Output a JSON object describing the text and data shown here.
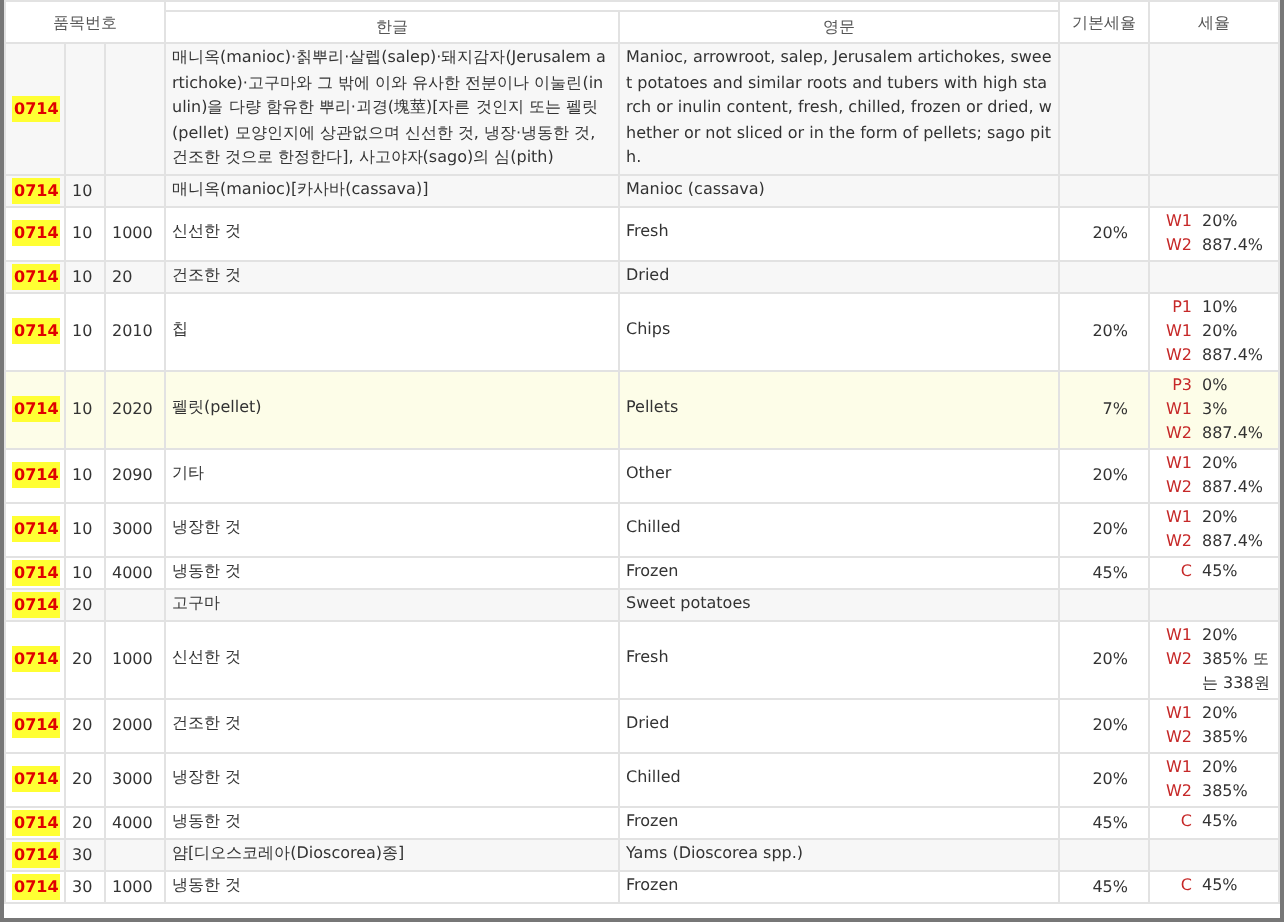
{
  "header": {
    "code": "품목번호",
    "korean": "한글",
    "english": "영문",
    "base_rate": "기본세율",
    "concession_rate": "세율"
  },
  "rows": [
    {
      "kind": "heading",
      "highlighted": false,
      "heading": "0714",
      "sub1": "",
      "sub2": "",
      "korean": "매니옥(manioc)·칡뿌리·살렙(salep)·돼지감자(Jerusalem artichoke)·고구마와 그 밖에 이와 유사한 전분이나 이눌린(inulin)을 다량 함유한 뿌리·괴경(塊莖)[자른 것인지 또는 펠릿(pellet) 모양인지에 상관없으며 신선한 것, 냉장·냉동한 것, 건조한 것으로 한정한다], 사고야자(sago)의 심(pith)",
      "english": "Manioc, arrowroot, salep, Jerusalem artichokes, sweet potatoes and similar roots and tubers with high starch or inulin content, fresh, chilled, frozen or dried, whether or not sliced or in the form of pellets; sago pith.",
      "base": "",
      "rates": []
    },
    {
      "kind": "heading",
      "highlighted": false,
      "heading": "0714",
      "sub1": "10",
      "sub2": "",
      "korean": "매니옥(manioc)[카사바(cassava)]",
      "english": "Manioc (cassava)",
      "base": "",
      "rates": []
    },
    {
      "kind": "item",
      "highlighted": false,
      "heading": "0714",
      "sub1": "10",
      "sub2": "1000",
      "korean": "신선한 것",
      "english": "Fresh",
      "base": "20%",
      "rates": [
        {
          "code": "W1",
          "value": "20%"
        },
        {
          "code": "W2",
          "value": "887.4%"
        }
      ]
    },
    {
      "kind": "heading",
      "highlighted": false,
      "heading": "0714",
      "sub1": "10",
      "sub2": "20",
      "korean": "건조한 것",
      "english": "Dried",
      "base": "",
      "rates": []
    },
    {
      "kind": "item",
      "highlighted": false,
      "heading": "0714",
      "sub1": "10",
      "sub2": "2010",
      "korean": "칩",
      "english": "Chips",
      "base": "20%",
      "rates": [
        {
          "code": "P1",
          "value": "10%"
        },
        {
          "code": "W1",
          "value": "20%"
        },
        {
          "code": "W2",
          "value": "887.4%"
        }
      ]
    },
    {
      "kind": "item",
      "highlighted": true,
      "heading": "0714",
      "sub1": "10",
      "sub2": "2020",
      "korean": "펠릿(pellet)",
      "english": "Pellets",
      "base": "7%",
      "rates": [
        {
          "code": "P3",
          "value": "0%"
        },
        {
          "code": "W1",
          "value": "3%"
        },
        {
          "code": "W2",
          "value": "887.4%"
        }
      ]
    },
    {
      "kind": "item",
      "highlighted": false,
      "heading": "0714",
      "sub1": "10",
      "sub2": "2090",
      "korean": "기타",
      "english": "Other",
      "base": "20%",
      "rates": [
        {
          "code": "W1",
          "value": "20%"
        },
        {
          "code": "W2",
          "value": "887.4%"
        }
      ]
    },
    {
      "kind": "item",
      "highlighted": false,
      "heading": "0714",
      "sub1": "10",
      "sub2": "3000",
      "korean": "냉장한 것",
      "english": "Chilled",
      "base": "20%",
      "rates": [
        {
          "code": "W1",
          "value": "20%"
        },
        {
          "code": "W2",
          "value": "887.4%"
        }
      ]
    },
    {
      "kind": "item",
      "highlighted": false,
      "heading": "0714",
      "sub1": "10",
      "sub2": "4000",
      "korean": "냉동한 것",
      "english": "Frozen",
      "base": "45%",
      "rates": [
        {
          "code": "C",
          "value": "45%"
        }
      ]
    },
    {
      "kind": "heading",
      "highlighted": false,
      "heading": "0714",
      "sub1": "20",
      "sub2": "",
      "korean": "고구마",
      "english": "Sweet potatoes",
      "base": "",
      "rates": []
    },
    {
      "kind": "item",
      "highlighted": false,
      "heading": "0714",
      "sub1": "20",
      "sub2": "1000",
      "korean": "신선한 것",
      "english": "Fresh",
      "base": "20%",
      "rates": [
        {
          "code": "W1",
          "value": "20%"
        },
        {
          "code": "W2",
          "value": "385% 또는 338원"
        }
      ]
    },
    {
      "kind": "item",
      "highlighted": false,
      "heading": "0714",
      "sub1": "20",
      "sub2": "2000",
      "korean": "건조한 것",
      "english": "Dried",
      "base": "20%",
      "rates": [
        {
          "code": "W1",
          "value": "20%"
        },
        {
          "code": "W2",
          "value": "385%"
        }
      ]
    },
    {
      "kind": "item",
      "highlighted": false,
      "heading": "0714",
      "sub1": "20",
      "sub2": "3000",
      "korean": "냉장한 것",
      "english": "Chilled",
      "base": "20%",
      "rates": [
        {
          "code": "W1",
          "value": "20%"
        },
        {
          "code": "W2",
          "value": "385%"
        }
      ]
    },
    {
      "kind": "item",
      "highlighted": false,
      "heading": "0714",
      "sub1": "20",
      "sub2": "4000",
      "korean": "냉동한 것",
      "english": "Frozen",
      "base": "45%",
      "rates": [
        {
          "code": "C",
          "value": "45%"
        }
      ]
    },
    {
      "kind": "heading",
      "highlighted": false,
      "heading": "0714",
      "sub1": "30",
      "sub2": "",
      "korean": "얌[디오스코레아(Dioscorea)종]",
      "english": "Yams (Dioscorea spp.)",
      "base": "",
      "rates": []
    },
    {
      "kind": "item",
      "highlighted": false,
      "heading": "0714",
      "sub1": "30",
      "sub2": "1000",
      "korean": "냉동한 것",
      "english": "Frozen",
      "base": "45%",
      "rates": [
        {
          "code": "C",
          "value": "45%"
        }
      ]
    }
  ]
}
